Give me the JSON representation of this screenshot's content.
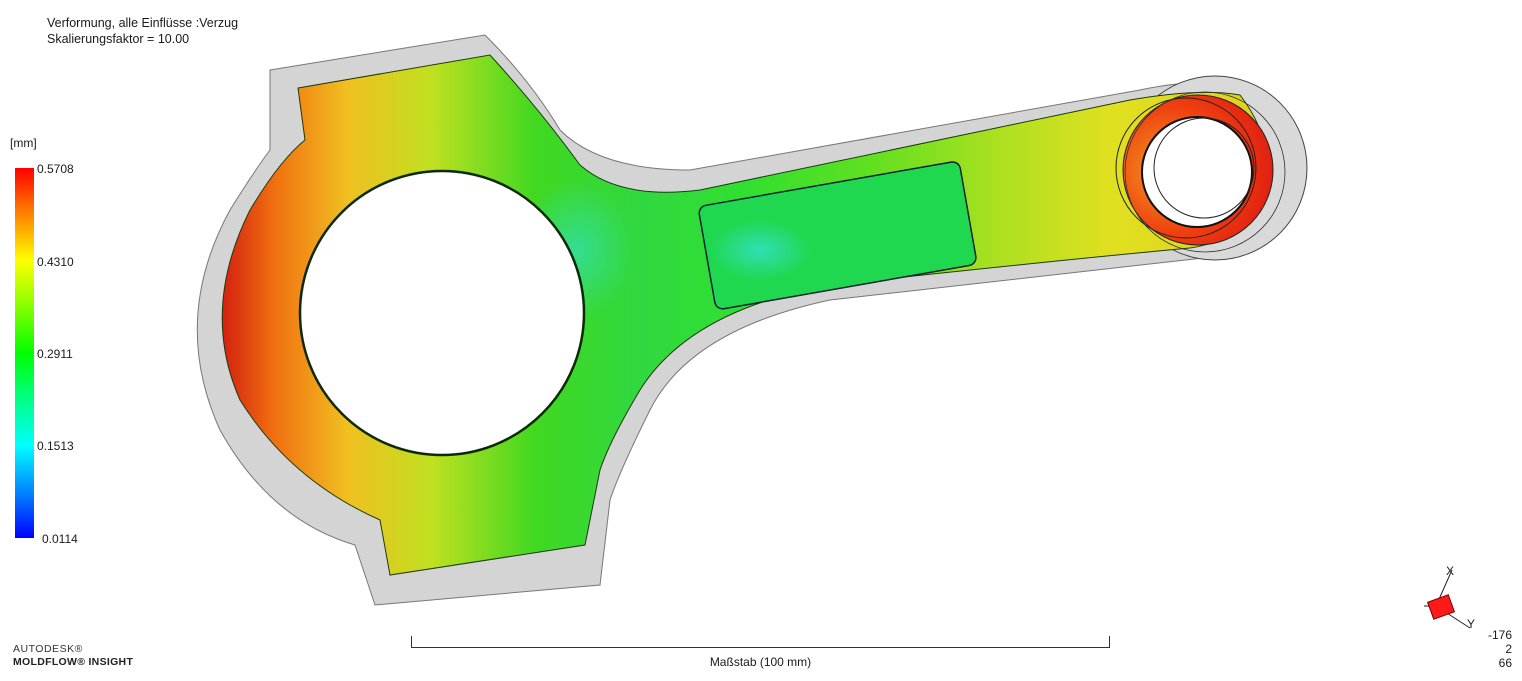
{
  "result": {
    "title": "Verformung, alle Einflüsse :Verzug",
    "scale_factor": "Skalierungsfaktor = 10.00"
  },
  "legend": {
    "unit": "[mm]",
    "max": "0.5708",
    "t2": "0.4310",
    "t3": "0.2911",
    "t4": "0.1513",
    "min": "0.0114"
  },
  "scale_bar": {
    "label": "Maßstab (100 mm)"
  },
  "brand": {
    "line1": "AUTODESK®",
    "line2": "MOLDFLOW® INSIGHT"
  },
  "triad": {
    "x_label": "X",
    "y_label": "Y"
  },
  "view": {
    "c1": "-176",
    "c2": "2",
    "c3": "66"
  },
  "colors": {
    "max": "#ff0000",
    "mid": "#00ff00",
    "min": "#0000ff"
  }
}
